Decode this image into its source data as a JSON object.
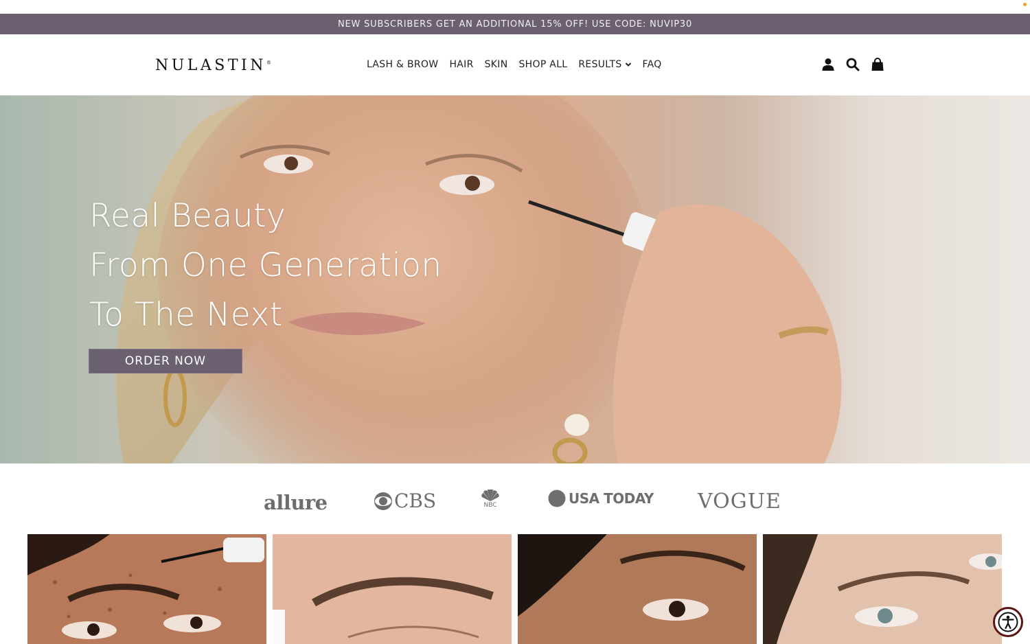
{
  "promo": {
    "text": "NEW SUBSCRIBERS GET AN ADDITIONAL 15% OFF! USE CODE: NUVIP30"
  },
  "header": {
    "logo": "NULASTIN",
    "logo_mark": "®",
    "nav": [
      {
        "label": "LASH & BROW"
      },
      {
        "label": "HAIR"
      },
      {
        "label": "SKIN"
      },
      {
        "label": "SHOP ALL"
      },
      {
        "label": "RESULTS",
        "has_dropdown": true
      },
      {
        "label": "FAQ"
      }
    ],
    "icons": [
      "account-icon",
      "search-icon",
      "cart-icon"
    ]
  },
  "hero": {
    "lines": [
      "Real Beauty",
      "From One Generation",
      "To The Next"
    ],
    "cta": "ORDER NOW"
  },
  "press": {
    "logos": [
      {
        "name": "allure",
        "text": "allure"
      },
      {
        "name": "cbs",
        "text": "CBS"
      },
      {
        "name": "nbc",
        "text": "NBC"
      },
      {
        "name": "usa-today",
        "text": "USA TODAY"
      },
      {
        "name": "vogue",
        "text": "VOGUE"
      }
    ]
  },
  "colors": {
    "promo_bg": "#6b6070",
    "button_bg": "#6b6070",
    "press_gray": "#6e6e6e",
    "accessibility_ring": "#5a1414"
  }
}
